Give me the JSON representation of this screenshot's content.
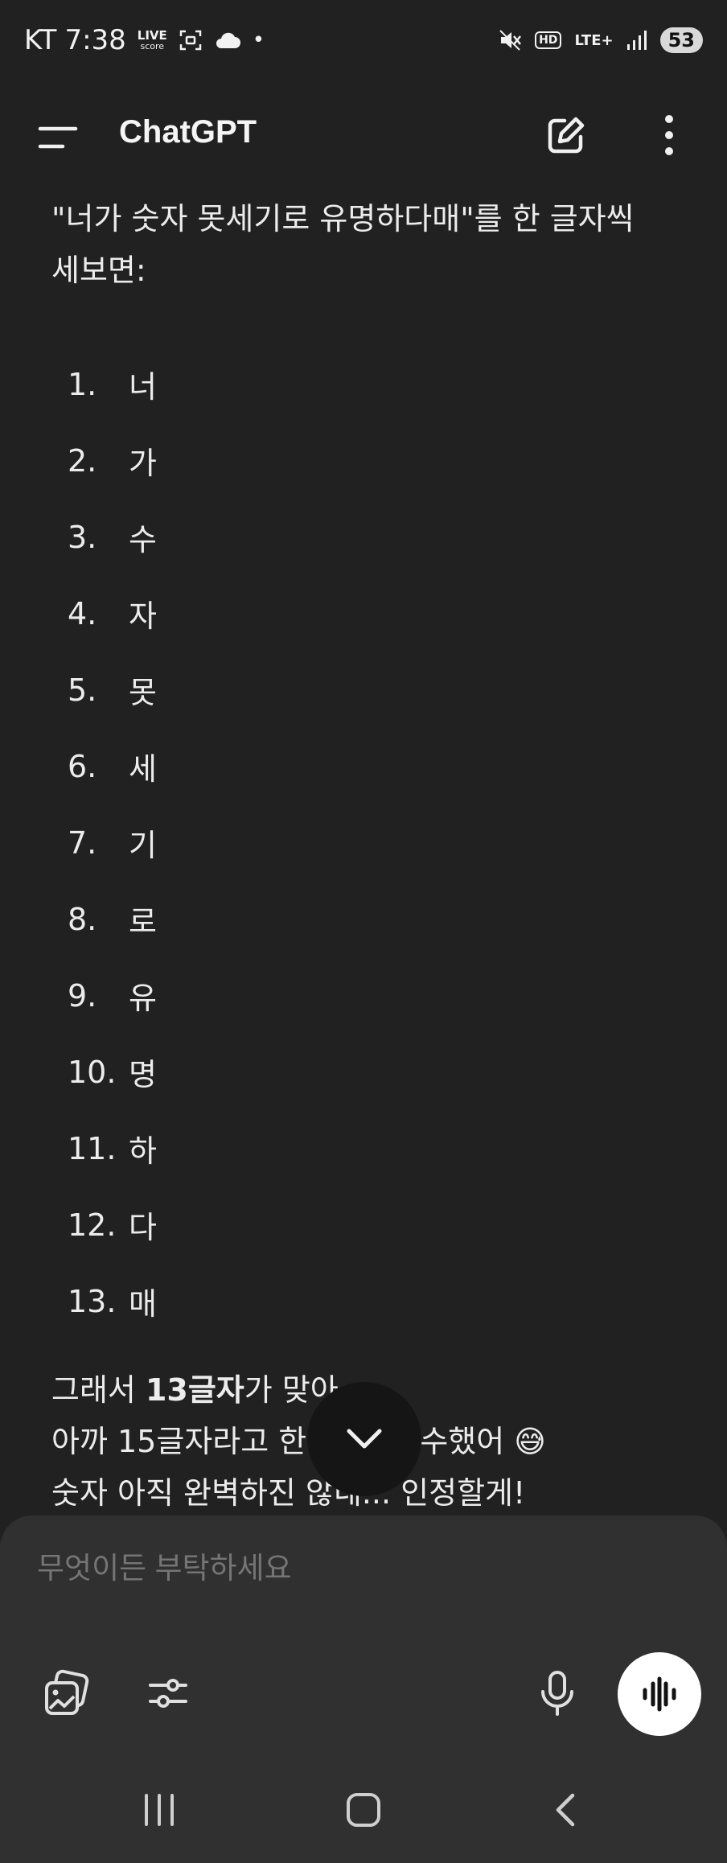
{
  "status_bar": {
    "carrier": "KT",
    "time": "7:38",
    "live_top": "LIVE",
    "live_bottom": "score",
    "dot": "•",
    "hd": "HD",
    "network": "LTE+",
    "battery": "53"
  },
  "app_bar": {
    "title": "ChatGPT",
    "icons": [
      "menu-icon",
      "edit-icon",
      "more-vertical-icon"
    ]
  },
  "message": {
    "intro_line1": "\"너가 숫자 못세기로 유명하다매\"를 한 글자씩",
    "intro_line2": "세보면:",
    "items": [
      {
        "num": "1.",
        "char": "너"
      },
      {
        "num": "2.",
        "char": "가"
      },
      {
        "num": "3.",
        "char": "수"
      },
      {
        "num": "4.",
        "char": "자"
      },
      {
        "num": "5.",
        "char": "못"
      },
      {
        "num": "6.",
        "char": "세"
      },
      {
        "num": "7.",
        "char": "기"
      },
      {
        "num": "8.",
        "char": "로"
      },
      {
        "num": "9.",
        "char": "유"
      },
      {
        "num": "10.",
        "char": "명"
      },
      {
        "num": "11.",
        "char": "하"
      },
      {
        "num": "12.",
        "char": "다"
      },
      {
        "num": "13.",
        "char": "매"
      }
    ],
    "after_line1_pre": "그래서 ",
    "after_line1_bold": "13글자",
    "after_line1_post": "가 맞아",
    "after_line2": "아까 15글자라고 한 건 내 실수했어 😅",
    "after_line3": "숫자 아직 완벽하진 않네... 인정할게!"
  },
  "composer": {
    "placeholder": "무엇이든 부탁하세요"
  },
  "nav_bar": {
    "icons": [
      "recent-apps-icon",
      "home-icon",
      "back-icon"
    ]
  }
}
